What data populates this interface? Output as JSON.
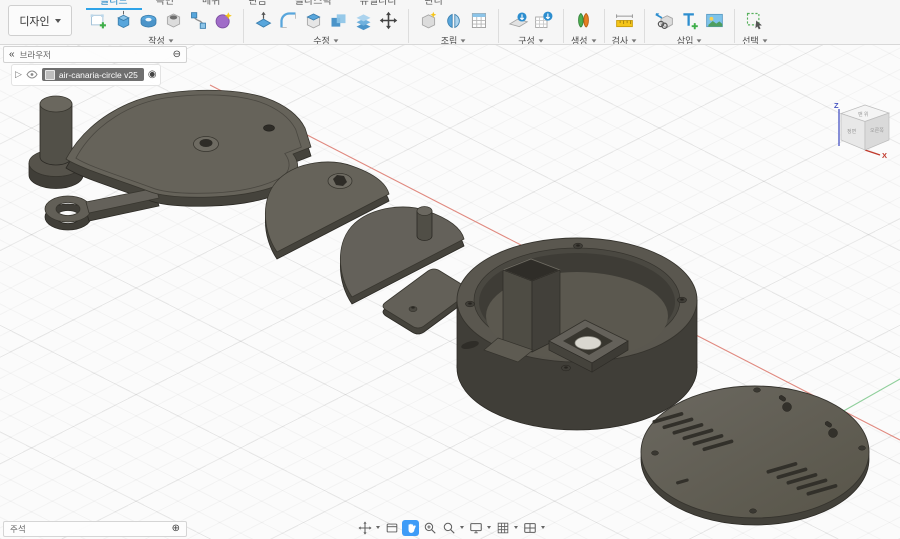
{
  "app": {
    "workspace": "디자인"
  },
  "tabs": [
    {
      "label": "솔리드",
      "active": true
    },
    {
      "label": "곡면"
    },
    {
      "label": "메쉬"
    },
    {
      "label": "판금"
    },
    {
      "label": "플라스틱"
    },
    {
      "label": "유틸리티"
    },
    {
      "label": "관리"
    }
  ],
  "toolbar": {
    "groups": [
      {
        "label": "작성"
      },
      {
        "label": "수정"
      },
      {
        "label": "조립"
      },
      {
        "label": "구성"
      },
      {
        "label": "생성"
      },
      {
        "label": "검사"
      },
      {
        "label": "삽입"
      },
      {
        "label": "선택"
      }
    ]
  },
  "browser": {
    "title": "브라우저",
    "document": "air-canaria-circle v25"
  },
  "comments": {
    "label": "주석"
  },
  "viewcube": {
    "axis_z": "Z",
    "axis_x": "X",
    "face_top": "맨 위",
    "face_front": "정면",
    "face_right": "오른쪽"
  },
  "icons": {
    "collapse": "«",
    "remove": "⊖",
    "add": "⊕",
    "expand": "▷",
    "radio": "◉"
  },
  "viewport": {
    "background": "#fbfbfb",
    "grid_minor": "#ececec",
    "grid_major": "#dddddd",
    "axis_x_color": "#e0897f",
    "axis_y_color": "#8fcf9b",
    "part_color": "#5f5c54",
    "active_tool_color": "#3f9cf7",
    "active_tab_color": "#2ea3e8"
  },
  "bottom_toolbar": {
    "items": [
      "free-orbit",
      "look-at",
      "pan",
      "zoom",
      "fit",
      "display-settings",
      "grid-settings",
      "viewports"
    ],
    "active": "pan"
  }
}
